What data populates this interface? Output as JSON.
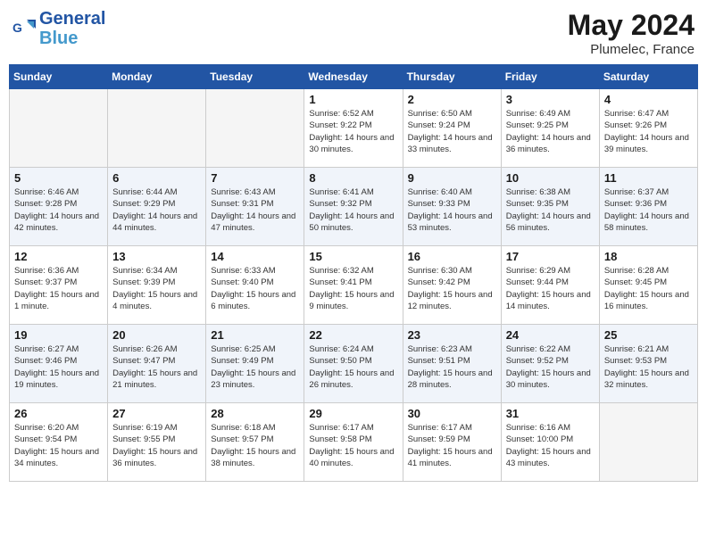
{
  "header": {
    "logo_line1": "General",
    "logo_line2": "Blue",
    "month_year": "May 2024",
    "location": "Plumelec, France"
  },
  "weekdays": [
    "Sunday",
    "Monday",
    "Tuesday",
    "Wednesday",
    "Thursday",
    "Friday",
    "Saturday"
  ],
  "weeks": [
    [
      {
        "day": "",
        "empty": true
      },
      {
        "day": "",
        "empty": true
      },
      {
        "day": "",
        "empty": true
      },
      {
        "day": "1",
        "sunrise": "6:52 AM",
        "sunset": "9:22 PM",
        "daylight": "14 hours and 30 minutes."
      },
      {
        "day": "2",
        "sunrise": "6:50 AM",
        "sunset": "9:24 PM",
        "daylight": "14 hours and 33 minutes."
      },
      {
        "day": "3",
        "sunrise": "6:49 AM",
        "sunset": "9:25 PM",
        "daylight": "14 hours and 36 minutes."
      },
      {
        "day": "4",
        "sunrise": "6:47 AM",
        "sunset": "9:26 PM",
        "daylight": "14 hours and 39 minutes."
      }
    ],
    [
      {
        "day": "5",
        "sunrise": "6:46 AM",
        "sunset": "9:28 PM",
        "daylight": "14 hours and 42 minutes."
      },
      {
        "day": "6",
        "sunrise": "6:44 AM",
        "sunset": "9:29 PM",
        "daylight": "14 hours and 44 minutes."
      },
      {
        "day": "7",
        "sunrise": "6:43 AM",
        "sunset": "9:31 PM",
        "daylight": "14 hours and 47 minutes."
      },
      {
        "day": "8",
        "sunrise": "6:41 AM",
        "sunset": "9:32 PM",
        "daylight": "14 hours and 50 minutes."
      },
      {
        "day": "9",
        "sunrise": "6:40 AM",
        "sunset": "9:33 PM",
        "daylight": "14 hours and 53 minutes."
      },
      {
        "day": "10",
        "sunrise": "6:38 AM",
        "sunset": "9:35 PM",
        "daylight": "14 hours and 56 minutes."
      },
      {
        "day": "11",
        "sunrise": "6:37 AM",
        "sunset": "9:36 PM",
        "daylight": "14 hours and 58 minutes."
      }
    ],
    [
      {
        "day": "12",
        "sunrise": "6:36 AM",
        "sunset": "9:37 PM",
        "daylight": "15 hours and 1 minute."
      },
      {
        "day": "13",
        "sunrise": "6:34 AM",
        "sunset": "9:39 PM",
        "daylight": "15 hours and 4 minutes."
      },
      {
        "day": "14",
        "sunrise": "6:33 AM",
        "sunset": "9:40 PM",
        "daylight": "15 hours and 6 minutes."
      },
      {
        "day": "15",
        "sunrise": "6:32 AM",
        "sunset": "9:41 PM",
        "daylight": "15 hours and 9 minutes."
      },
      {
        "day": "16",
        "sunrise": "6:30 AM",
        "sunset": "9:42 PM",
        "daylight": "15 hours and 12 minutes."
      },
      {
        "day": "17",
        "sunrise": "6:29 AM",
        "sunset": "9:44 PM",
        "daylight": "15 hours and 14 minutes."
      },
      {
        "day": "18",
        "sunrise": "6:28 AM",
        "sunset": "9:45 PM",
        "daylight": "15 hours and 16 minutes."
      }
    ],
    [
      {
        "day": "19",
        "sunrise": "6:27 AM",
        "sunset": "9:46 PM",
        "daylight": "15 hours and 19 minutes."
      },
      {
        "day": "20",
        "sunrise": "6:26 AM",
        "sunset": "9:47 PM",
        "daylight": "15 hours and 21 minutes."
      },
      {
        "day": "21",
        "sunrise": "6:25 AM",
        "sunset": "9:49 PM",
        "daylight": "15 hours and 23 minutes."
      },
      {
        "day": "22",
        "sunrise": "6:24 AM",
        "sunset": "9:50 PM",
        "daylight": "15 hours and 26 minutes."
      },
      {
        "day": "23",
        "sunrise": "6:23 AM",
        "sunset": "9:51 PM",
        "daylight": "15 hours and 28 minutes."
      },
      {
        "day": "24",
        "sunrise": "6:22 AM",
        "sunset": "9:52 PM",
        "daylight": "15 hours and 30 minutes."
      },
      {
        "day": "25",
        "sunrise": "6:21 AM",
        "sunset": "9:53 PM",
        "daylight": "15 hours and 32 minutes."
      }
    ],
    [
      {
        "day": "26",
        "sunrise": "6:20 AM",
        "sunset": "9:54 PM",
        "daylight": "15 hours and 34 minutes."
      },
      {
        "day": "27",
        "sunrise": "6:19 AM",
        "sunset": "9:55 PM",
        "daylight": "15 hours and 36 minutes."
      },
      {
        "day": "28",
        "sunrise": "6:18 AM",
        "sunset": "9:57 PM",
        "daylight": "15 hours and 38 minutes."
      },
      {
        "day": "29",
        "sunrise": "6:17 AM",
        "sunset": "9:58 PM",
        "daylight": "15 hours and 40 minutes."
      },
      {
        "day": "30",
        "sunrise": "6:17 AM",
        "sunset": "9:59 PM",
        "daylight": "15 hours and 41 minutes."
      },
      {
        "day": "31",
        "sunrise": "6:16 AM",
        "sunset": "10:00 PM",
        "daylight": "15 hours and 43 minutes."
      },
      {
        "day": "",
        "empty": true
      }
    ]
  ]
}
